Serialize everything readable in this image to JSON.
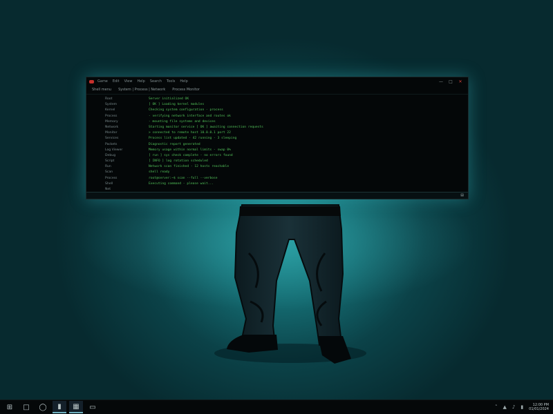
{
  "terminal": {
    "menu": [
      "Game",
      "Edit",
      "View",
      "Help",
      "Search",
      "Tools",
      "Help"
    ],
    "tabs": [
      "Shell menu",
      "System | Process | Network",
      "Process Monitor"
    ],
    "labels": [
      "Root",
      "System",
      "Kernel",
      "Process",
      "Memory",
      "Network",
      "Monitor",
      "Services",
      "Packets",
      "Log Viewer",
      "Debug",
      "Script",
      "Run",
      "Scan",
      "Process",
      "Shell",
      "Net"
    ],
    "lines": [
      "Server initialized OK",
      "[ OK ] Loading kernel modules",
      "Checking system configuration - process",
      "  - verifying network interface and routes ok",
      "  - mounting file systems and devices",
      "Starting monitor service [ OK ] awaiting connection requests",
      "  > connected to remote host 10.0.0.1 port 22",
      "Process list updated - 42 running - 3 sleeping",
      "  Diagnostic report generated",
      "      Memory usage within normal limits - swap 0%",
      "      [ run ] sys check complete - no errors found",
      "    [ INFO ] log rotation scheduled",
      "    Network scan finished - 12 hosts reachable",
      "      shell ready",
      "        root@server:~$ scan --full --verbose",
      "  Executing command - please wait..."
    ],
    "scroll_indicator": "▤"
  },
  "taskbar": {
    "start_icon": "windows-start-icon",
    "clock_time": "12:00 PM",
    "clock_date": "01/01/2024"
  },
  "colors": {
    "terminal_text": "#53c35a",
    "background_glow": "#1f8f93"
  }
}
